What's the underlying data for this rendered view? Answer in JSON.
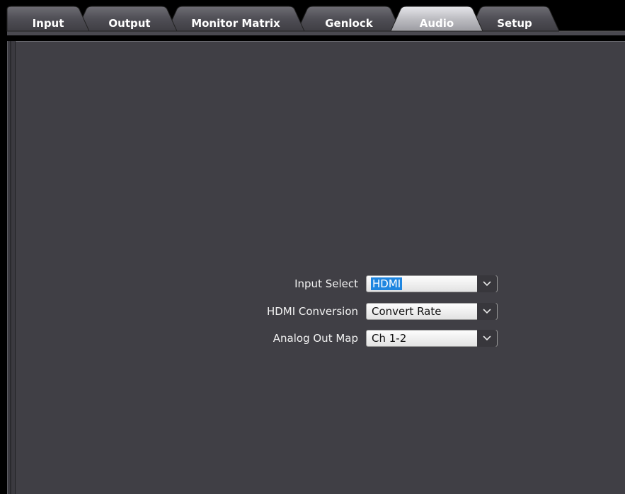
{
  "tabs": [
    {
      "label": "Input",
      "active": false
    },
    {
      "label": "Output",
      "active": false
    },
    {
      "label": "Monitor Matrix",
      "active": false
    },
    {
      "label": "Genlock",
      "active": false
    },
    {
      "label": "Audio",
      "active": true
    },
    {
      "label": "Setup",
      "active": false
    }
  ],
  "audio_settings": {
    "input_select": {
      "label": "Input Select",
      "value": "HDMI",
      "selected_text_highlighted": true
    },
    "hdmi_conversion": {
      "label": "HDMI Conversion",
      "value": "Convert Rate"
    },
    "analog_out_map": {
      "label": "Analog Out Map",
      "value": "Ch 1-2"
    }
  },
  "colors": {
    "panel_background": "#403f45",
    "tab_inactive": "#4a4950",
    "tab_active": "#b8b8bd",
    "selection_highlight": "#1f86e0"
  },
  "icons": {
    "dropdown": "chevron-down-icon"
  }
}
